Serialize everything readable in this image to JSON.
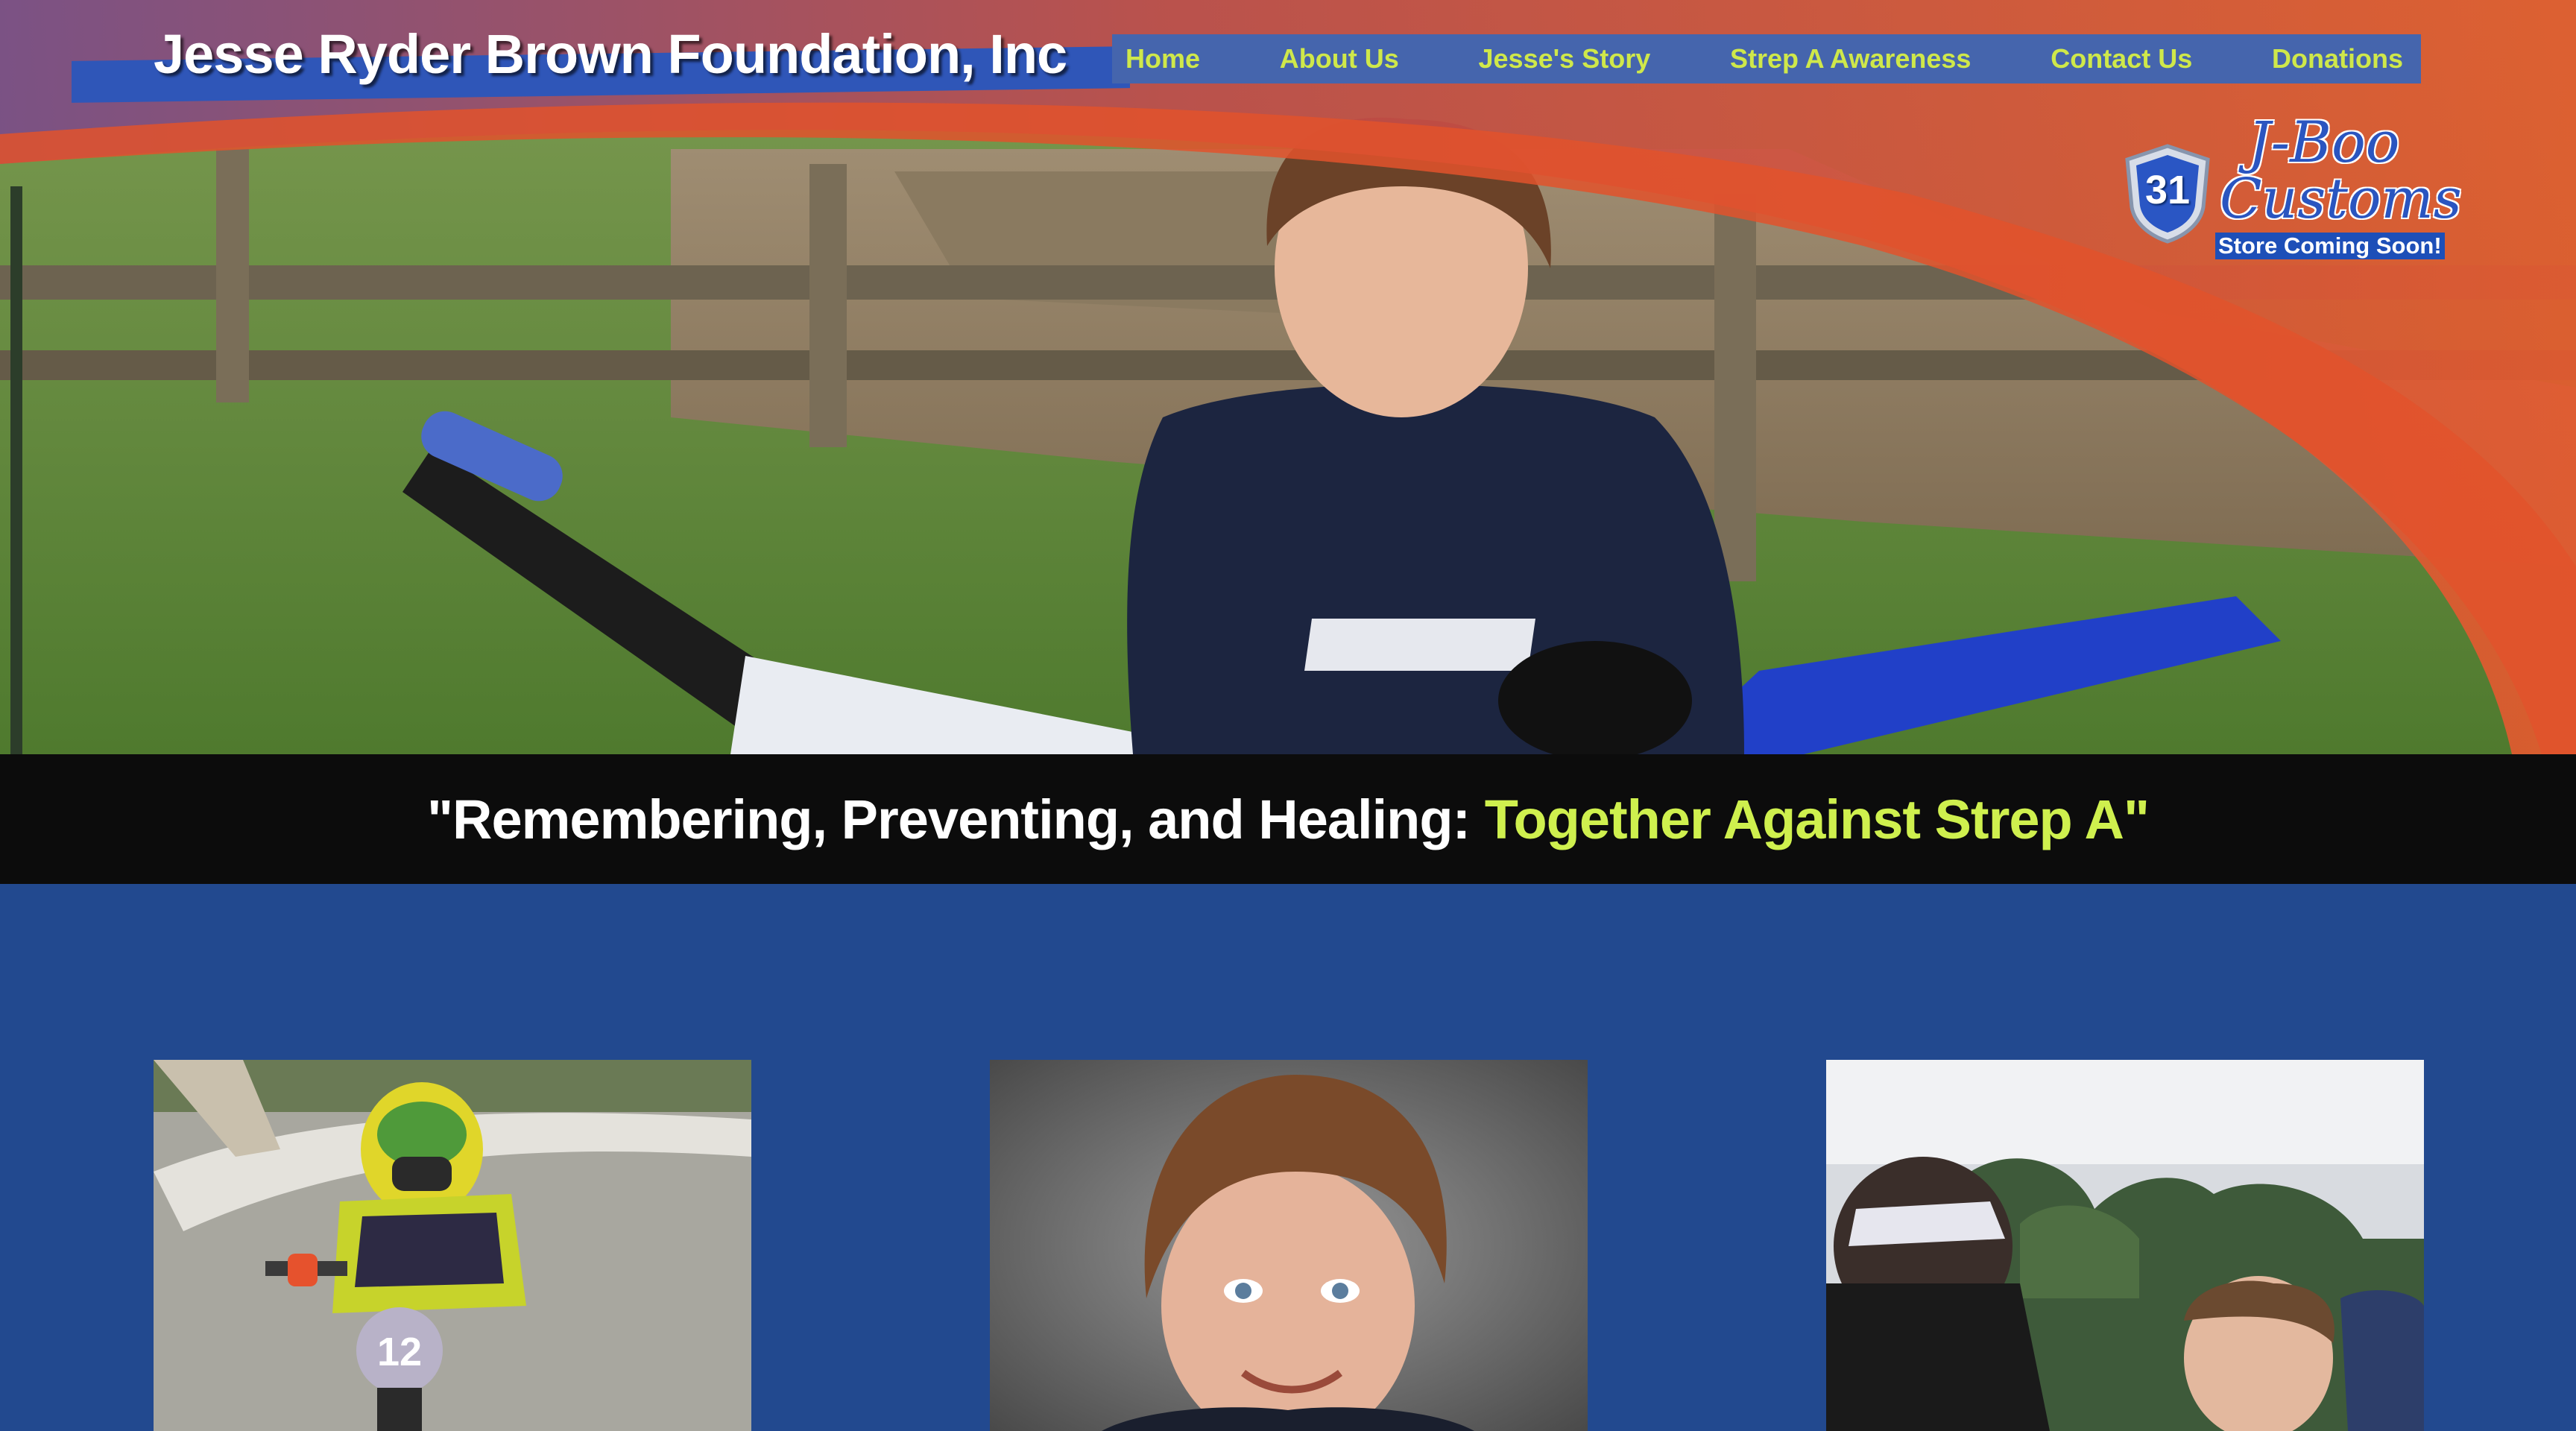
{
  "site": {
    "title": "Jesse Ryder Brown Foundation, Inc"
  },
  "nav": {
    "items": [
      {
        "label": "Home"
      },
      {
        "label": "About Us"
      },
      {
        "label": "Jesse's Story"
      },
      {
        "label": "Strep A Awareness"
      },
      {
        "label": "Contact Us"
      },
      {
        "label": "Donations"
      }
    ]
  },
  "hero": {
    "photo": "boy in motocross jersey sitting on a dirt bike at a track"
  },
  "sponsor": {
    "badge_number": "31",
    "name_line1": "J-Boo",
    "name_line2": "Customs",
    "subtext": "Store Coming Soon!"
  },
  "tagline": {
    "main": "\"Remembering, Preventing, and Healing: ",
    "accent": "Together Against Strep A\""
  },
  "gallery": {
    "items": [
      {
        "photo": "young rider on BMX bike number 12 wearing helmet"
      },
      {
        "photo": "school portrait of smiling boy"
      },
      {
        "photo": "people at an outdoor event"
      }
    ]
  },
  "colors": {
    "nav_text": "#cfe84a",
    "nav_bg": "#4565ad",
    "page_bg": "#22498f",
    "tagline_accent": "#cff04e",
    "swoosh": "#e2522b"
  }
}
